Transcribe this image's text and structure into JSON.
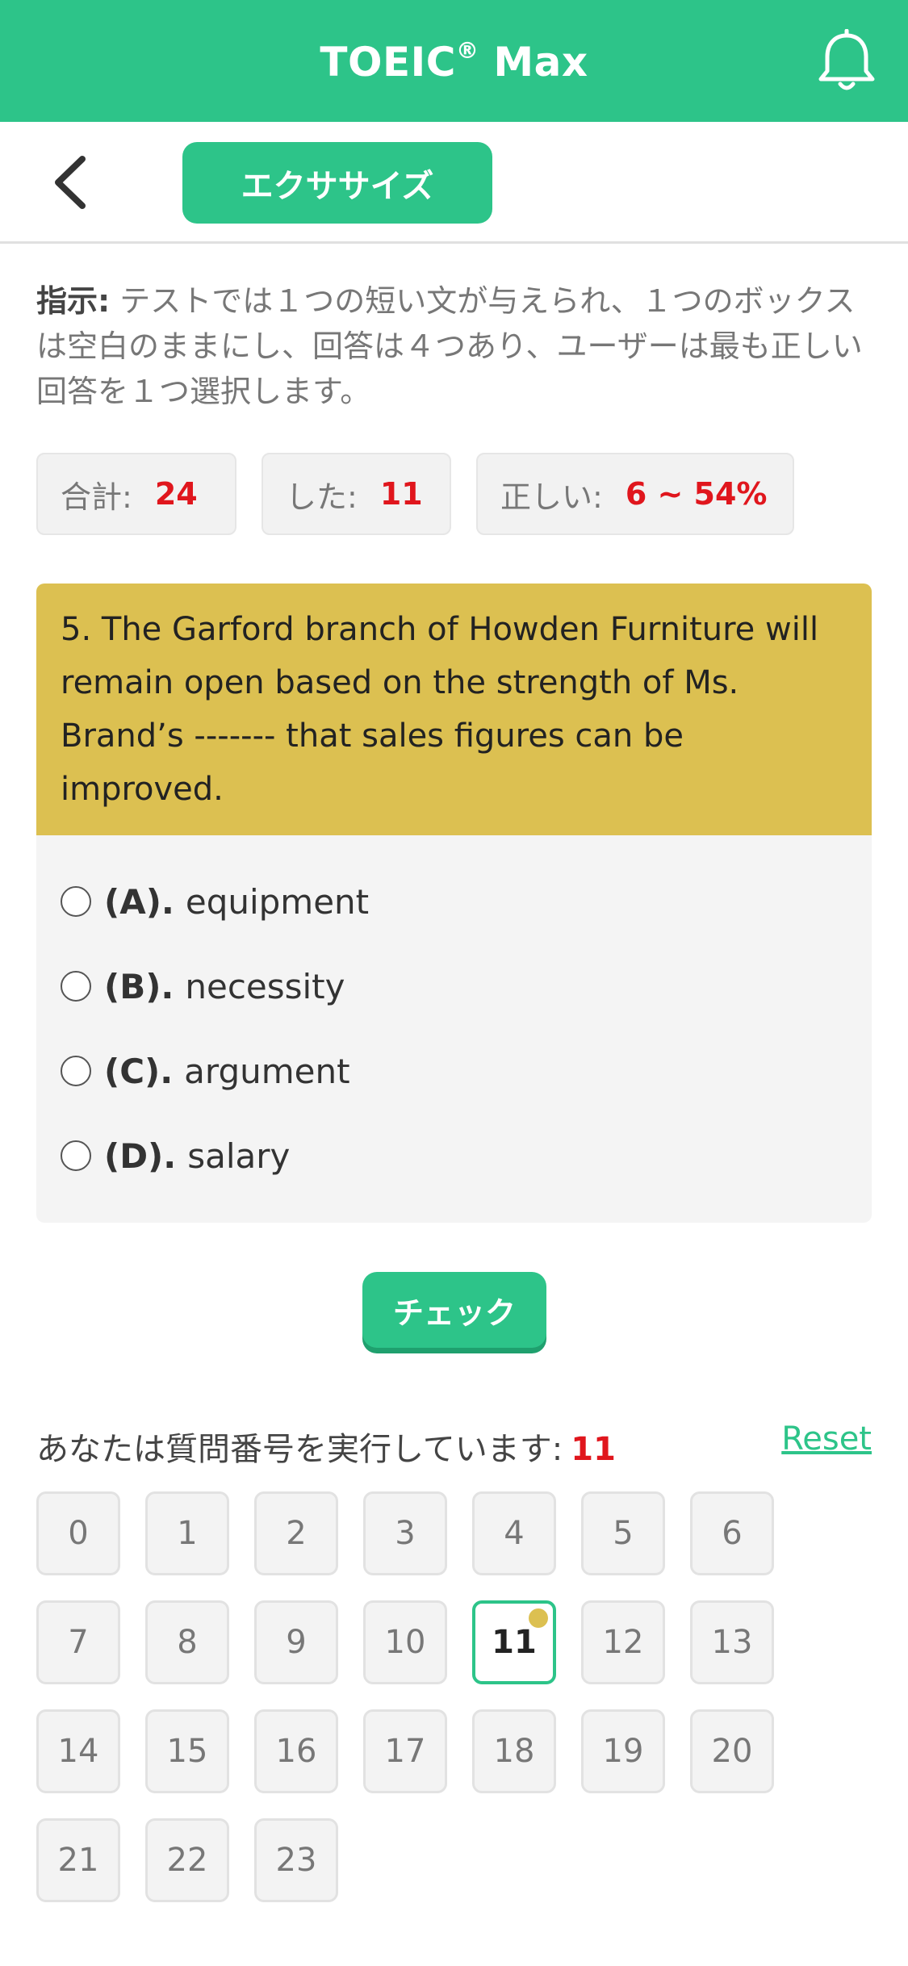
{
  "header": {
    "title": "TOEIC",
    "title_mark": "®",
    "title_suffix": " Max",
    "icons": {
      "right": "bell-icon"
    },
    "color": "#2dc489"
  },
  "nav": {
    "back_icon": "chevron-left-icon",
    "tab_label": "エクササイズ"
  },
  "instructions": {
    "label": "指示:",
    "text": " テストでは１つの短い文が与えられ、１つのボックスは空白のままにし、回答は４つあり、ユーザーは最も正しい回答を１つ選択します。"
  },
  "stats": [
    {
      "label": "合計:",
      "value": "24"
    },
    {
      "label": "した:",
      "value": "11"
    },
    {
      "label": "正しい:",
      "value": "6 ~ 54%"
    }
  ],
  "question": {
    "text": "5. The Garford branch of Howden Furniture will remain open based on the strength of Ms. Brand’s ------- that sales figures can be improved.",
    "options": [
      {
        "label": "(A).",
        "text": "equipment"
      },
      {
        "label": "(B).",
        "text": "necessity"
      },
      {
        "label": "(C).",
        "text": "argument"
      },
      {
        "label": "(D).",
        "text": "salary"
      }
    ]
  },
  "check_label": "チェック",
  "progress": {
    "running_label": "あなたは質問番号を実行しています:",
    "current": "11",
    "reset_label": "Reset",
    "numbers": [
      "0",
      "1",
      "2",
      "3",
      "4",
      "5",
      "6",
      "7",
      "8",
      "9",
      "10",
      "11",
      "12",
      "13",
      "14",
      "15",
      "16",
      "17",
      "18",
      "19",
      "20",
      "21",
      "22",
      "23"
    ],
    "active_index": 11
  },
  "colors": {
    "accent": "#2dc489",
    "question_bg": "#dcc051",
    "highlight": "#e0161d"
  }
}
